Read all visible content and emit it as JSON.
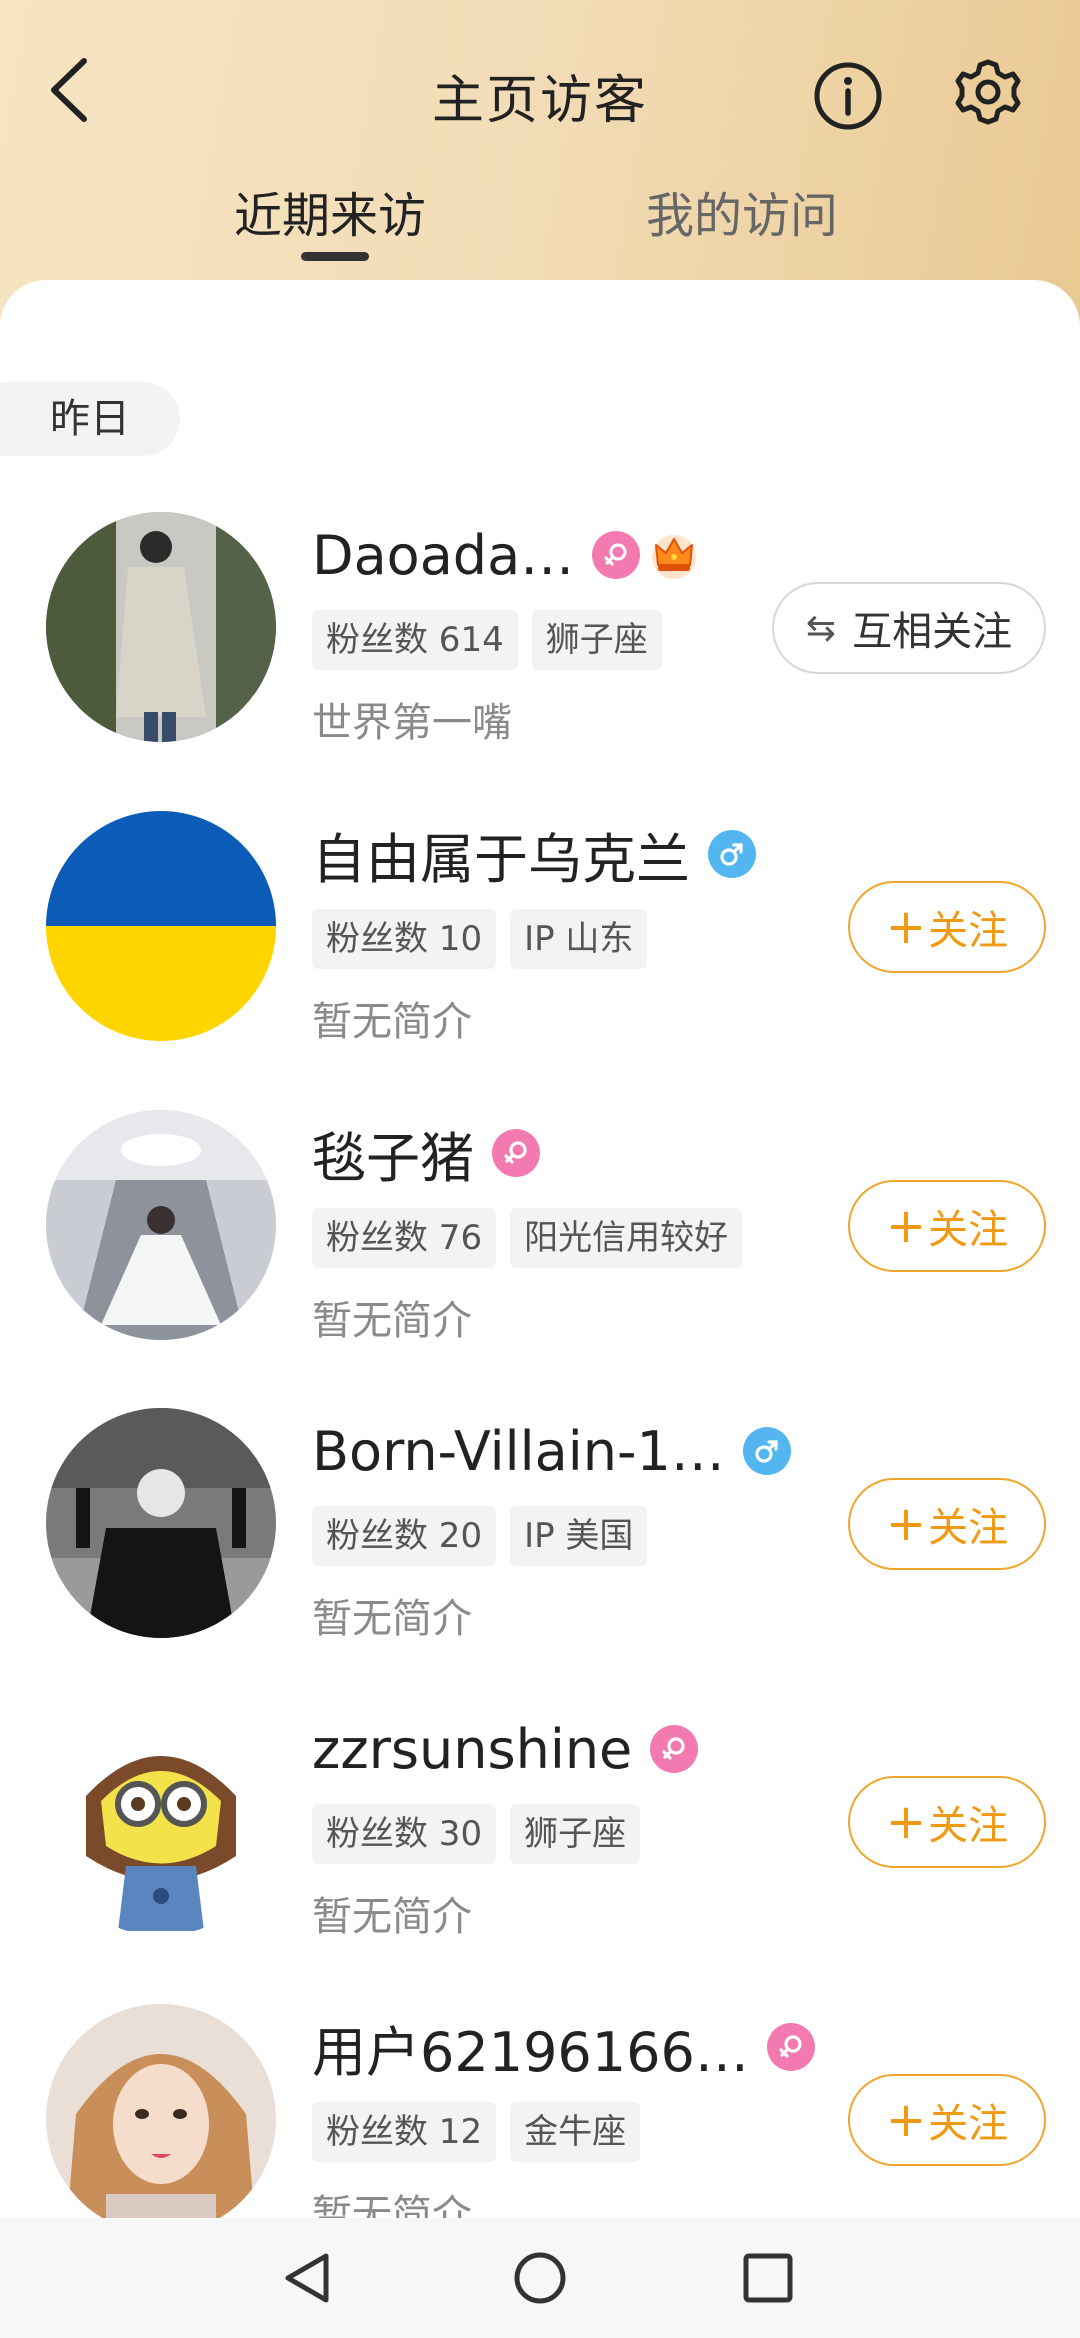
{
  "header": {
    "title": "主页访客",
    "back_icon": "chevron-left-icon",
    "info_icon": "info-icon",
    "settings_icon": "gear-icon"
  },
  "tabs": [
    {
      "label": "近期来访",
      "active": true
    },
    {
      "label": "我的访问",
      "active": false
    }
  ],
  "section_label": "昨日",
  "colors": {
    "accent_orange": "#f09a14",
    "female_badge": "#f37ab0",
    "male_badge": "#54b6f0",
    "header_gradient_start": "#f6e4c2",
    "header_gradient_end": "#e9c992"
  },
  "visitors": [
    {
      "name": "Daoada…",
      "gender": "female",
      "crown": true,
      "tags": [
        "粉丝数 614",
        "狮子座"
      ],
      "bio": "世界第一嘴",
      "action": "互相关注",
      "action_icon": "swap-arrows-icon"
    },
    {
      "name": "自由属于乌克兰",
      "gender": "male",
      "crown": false,
      "tags": [
        "粉丝数 10",
        "IP 山东"
      ],
      "bio": "暂无简介",
      "action": "关注"
    },
    {
      "name": "毯子猪",
      "gender": "female",
      "crown": false,
      "tags": [
        "粉丝数 76",
        "阳光信用较好"
      ],
      "bio": "暂无简介",
      "action": "关注"
    },
    {
      "name": "Born-Villain-1…",
      "gender": "male",
      "crown": false,
      "tags": [
        "粉丝数 20",
        "IP 美国"
      ],
      "bio": "暂无简介",
      "action": "关注"
    },
    {
      "name": "zzrsunshine",
      "gender": "female",
      "crown": false,
      "tags": [
        "粉丝数 30",
        "狮子座"
      ],
      "bio": "暂无简介",
      "action": "关注"
    },
    {
      "name": "用户62196166…",
      "gender": "female",
      "crown": false,
      "tags": [
        "粉丝数 12",
        "金牛座"
      ],
      "bio": "暂无简介",
      "action": "关注"
    }
  ],
  "follow_plus": "+",
  "navbar": {
    "back_icon": "triangle-back-icon",
    "home_icon": "circle-home-icon",
    "recents_icon": "square-recents-icon"
  }
}
